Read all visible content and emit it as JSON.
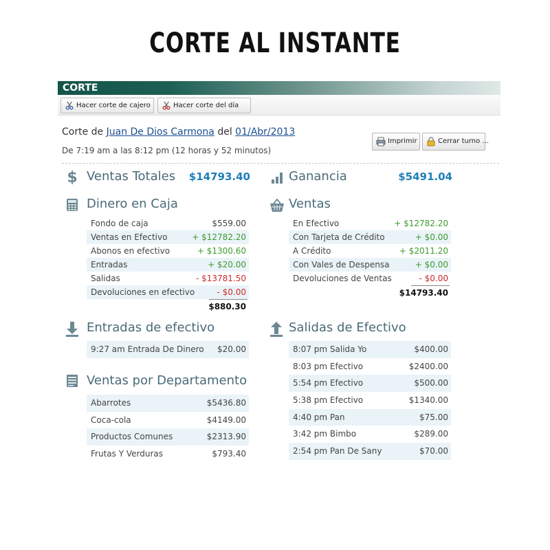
{
  "hero": {
    "title": "CORTE AL INSTANTE"
  },
  "window": {
    "title": "CORTE"
  },
  "toolbar": {
    "btn_cashier": "Hacer corte de cajero",
    "btn_day": "Hacer corte del día"
  },
  "cut": {
    "prefix": "Corte de",
    "cashier": "Juan De Dios Carmona",
    "mid": "del",
    "date": "01/Abr/2013",
    "time_range": "De 7:19 am a las 8:12 pm (12 horas y 52 minutos)"
  },
  "actions": {
    "print": "Imprimir",
    "close_shift": "Cerrar turno ..."
  },
  "ventas_totales": {
    "label": "Ventas Totales",
    "value": "$14793.40",
    "icon": "dollar-icon"
  },
  "ganancia": {
    "label": "Ganancia",
    "value": "$5491.04",
    "icon": "bar-chart-icon"
  },
  "dinero_caja": {
    "title": "Dinero en Caja",
    "icon": "calculator-icon",
    "rows": [
      {
        "label": "Fondo de caja",
        "value": "$559.00",
        "kind": "plain"
      },
      {
        "label": "Ventas en Efectivo",
        "value": "+ $12782.20",
        "kind": "pos"
      },
      {
        "label": "Abonos en efectivo",
        "value": "+ $1300.60",
        "kind": "pos"
      },
      {
        "label": "Entradas",
        "value": "+ $20.00",
        "kind": "pos"
      },
      {
        "label": "Salidas",
        "value": "- $13781.50",
        "kind": "neg"
      },
      {
        "label": "Devoluciones en efectivo",
        "value": "- $0.00",
        "kind": "neg"
      }
    ],
    "total": "$880.30"
  },
  "ventas": {
    "title": "Ventas",
    "icon": "basket-icon",
    "rows": [
      {
        "label": "En Efectivo",
        "value": "+ $12782.20",
        "kind": "pos"
      },
      {
        "label": "Con Tarjeta de Crédito",
        "value": "+ $0.00",
        "kind": "pos"
      },
      {
        "label": "A Crédito",
        "value": "+ $2011.20",
        "kind": "pos"
      },
      {
        "label": "Con Vales de Despensa",
        "value": "+ $0.00",
        "kind": "pos"
      },
      {
        "label": "Devoluciones de Ventas",
        "value": "- $0.00",
        "kind": "neg"
      }
    ],
    "total": "$14793.40"
  },
  "entradas": {
    "title": "Entradas de efectivo",
    "icon": "arrow-down-icon",
    "items": [
      {
        "label": "9:27 am Entrada De Dinero",
        "value": "$20.00"
      }
    ]
  },
  "salidas": {
    "title": "Salidas de Efectivo",
    "icon": "arrow-up-icon",
    "items": [
      {
        "label": "8:07 pm Salida Yo",
        "value": "$400.00"
      },
      {
        "label": "8:03 pm Efectivo",
        "value": "$2400.00"
      },
      {
        "label": "5:54 pm Efectivo",
        "value": "$500.00"
      },
      {
        "label": "5:38 pm Efectivo",
        "value": "$1340.00"
      },
      {
        "label": "4:40 pm Pan",
        "value": "$75.00"
      },
      {
        "label": "3:42 pm Bimbo",
        "value": "$289.00"
      },
      {
        "label": "2:54 pm Pan De Sany",
        "value": "$70.00"
      }
    ]
  },
  "departamentos": {
    "title": "Ventas por Departamento",
    "icon": "document-icon",
    "items": [
      {
        "label": "Abarrotes",
        "value": "$5436.80"
      },
      {
        "label": "Coca-cola",
        "value": "$4149.00"
      },
      {
        "label": "Productos Comunes",
        "value": "$2313.90"
      },
      {
        "label": "Frutas Y Verduras",
        "value": "$793.40"
      }
    ]
  }
}
